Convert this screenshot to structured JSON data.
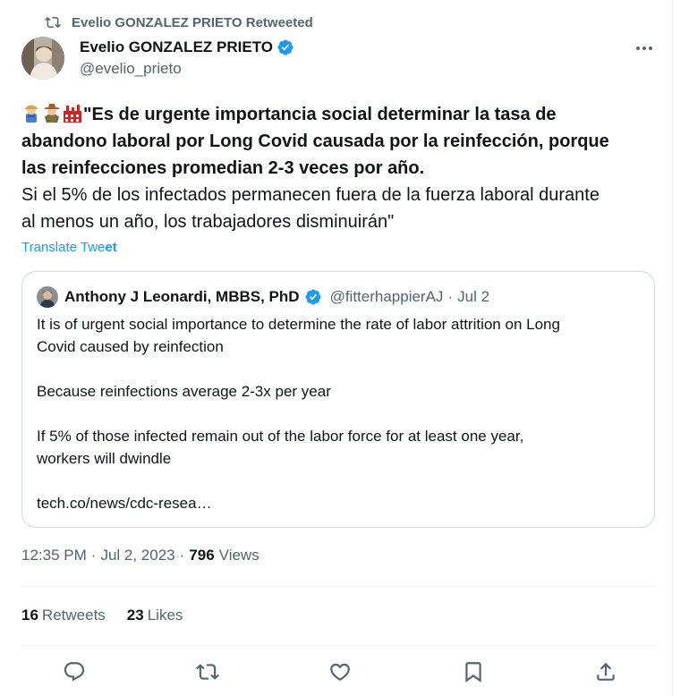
{
  "retweet_banner": {
    "text": "Evelio GONZALEZ PRIETO Retweeted",
    "icon": "retweet-icon"
  },
  "author": {
    "name": "Evelio GONZALEZ PRIETO",
    "handle": "@evelio_prieto",
    "verified_color": "#1d9bf0"
  },
  "tweet": {
    "emojis": [
      "farmer-emoji",
      "cowboy-emoji",
      "factory-emoji"
    ],
    "bold_line1": "\"Es de urgente importancia social determinar la tasa de",
    "bold_line2": "abandono laboral por Long Covid causada por la reinfección, porque",
    "bold_line3": "las reinfecciones promedian 2-3 veces por año.",
    "normal_line1": "Si el 5% de los infectados permanecen fuera de la fuerza laboral durante",
    "normal_line2": "al menos un año, los trabajadores disminuirán\"",
    "translate_prefix": "Translate Twe",
    "translate_suffix": "et"
  },
  "quote": {
    "name": "Anthony J Leonardi, MBBS, PhD",
    "handle": "@fitterhappierAJ",
    "separator": "·",
    "date": "Jul 2",
    "lines": [
      "It is of urgent social importance to determine the rate of labor attrition on Long",
      "Covid caused by reinfection",
      "",
      "Because reinfections average 2-3x per year",
      "",
      "If 5% of those infected remain out of the labor force for at least one year,",
      "workers will dwindle",
      "",
      "tech.co/news/cdc-resea…"
    ]
  },
  "meta": {
    "time": "12:35 PM",
    "separator": "·",
    "date": "Jul 2, 2023",
    "views_count": "796",
    "views_label": "Views"
  },
  "stats": {
    "retweets_count": "16",
    "retweets_label": "Retweets",
    "likes_count": "23",
    "likes_label": "Likes"
  },
  "actions": [
    "reply-icon",
    "retweet-icon",
    "like-icon",
    "bookmark-icon",
    "share-icon"
  ],
  "colors": {
    "accent": "#1d9bf0",
    "muted": "#536471",
    "text": "#0f1419",
    "border": "#cfd9de"
  }
}
